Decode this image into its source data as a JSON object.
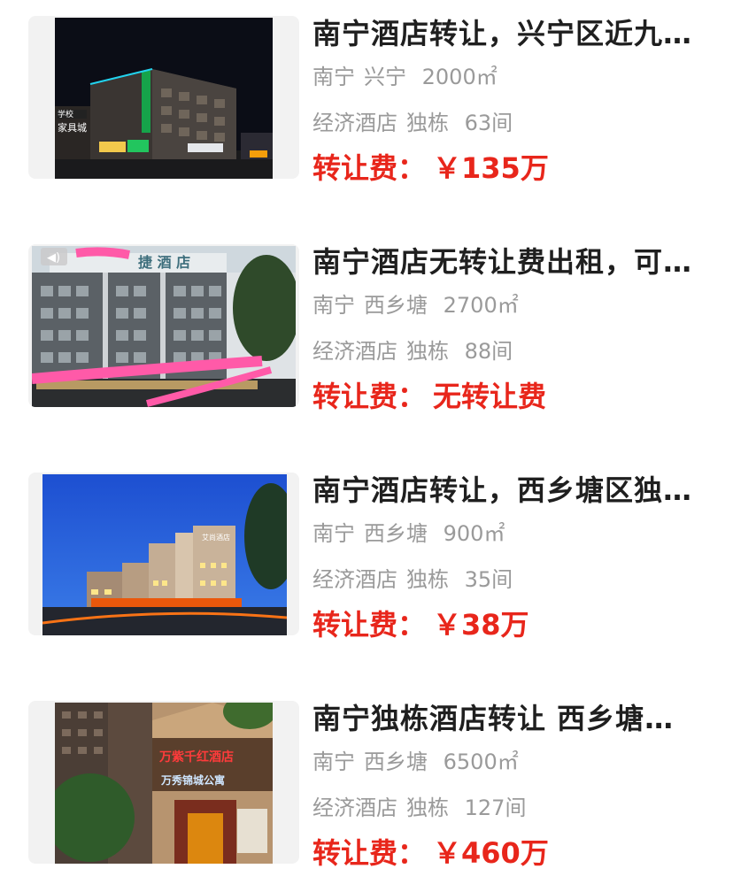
{
  "listings": [
    {
      "title": "南宁酒店转让，兴宁区近九…",
      "city": "南宁",
      "district": "兴宁",
      "area": "2000㎡",
      "hotel_type": "经济酒店",
      "building": "独栋",
      "rooms": "63间",
      "fee_label": "转让费：",
      "fee_value": "￥135万",
      "photo_signs": [
        "学校",
        "家具城"
      ]
    },
    {
      "title": "南宁酒店无转让费出租，可…",
      "city": "南宁",
      "district": "西乡塘",
      "area": "2700㎡",
      "hotel_type": "经济酒店",
      "building": "独栋",
      "rooms": "88间",
      "fee_label": "转让费：",
      "fee_value": "无转让费",
      "photo_signs": [
        "捷 酒 店"
      ]
    },
    {
      "title": "南宁酒店转让，西乡塘区独…",
      "city": "南宁",
      "district": "西乡塘",
      "area": "900㎡",
      "hotel_type": "经济酒店",
      "building": "独栋",
      "rooms": "35间",
      "fee_label": "转让费：",
      "fee_value": "￥38万",
      "photo_signs": [
        "艾尚酒店"
      ]
    },
    {
      "title": "南宁独栋酒店转让 西乡塘…",
      "city": "南宁",
      "district": "西乡塘",
      "area": "6500㎡",
      "hotel_type": "经济酒店",
      "building": "独栋",
      "rooms": "127间",
      "fee_label": "转让费：",
      "fee_value": "￥460万",
      "photo_signs": [
        "万紫千红酒店",
        "万秀锦城公寓"
      ]
    }
  ],
  "colors": {
    "title": "#1f1f1f",
    "meta": "#9a9a9a",
    "fee": "#e8261b",
    "thumb_bg": "#f2f2f2"
  }
}
